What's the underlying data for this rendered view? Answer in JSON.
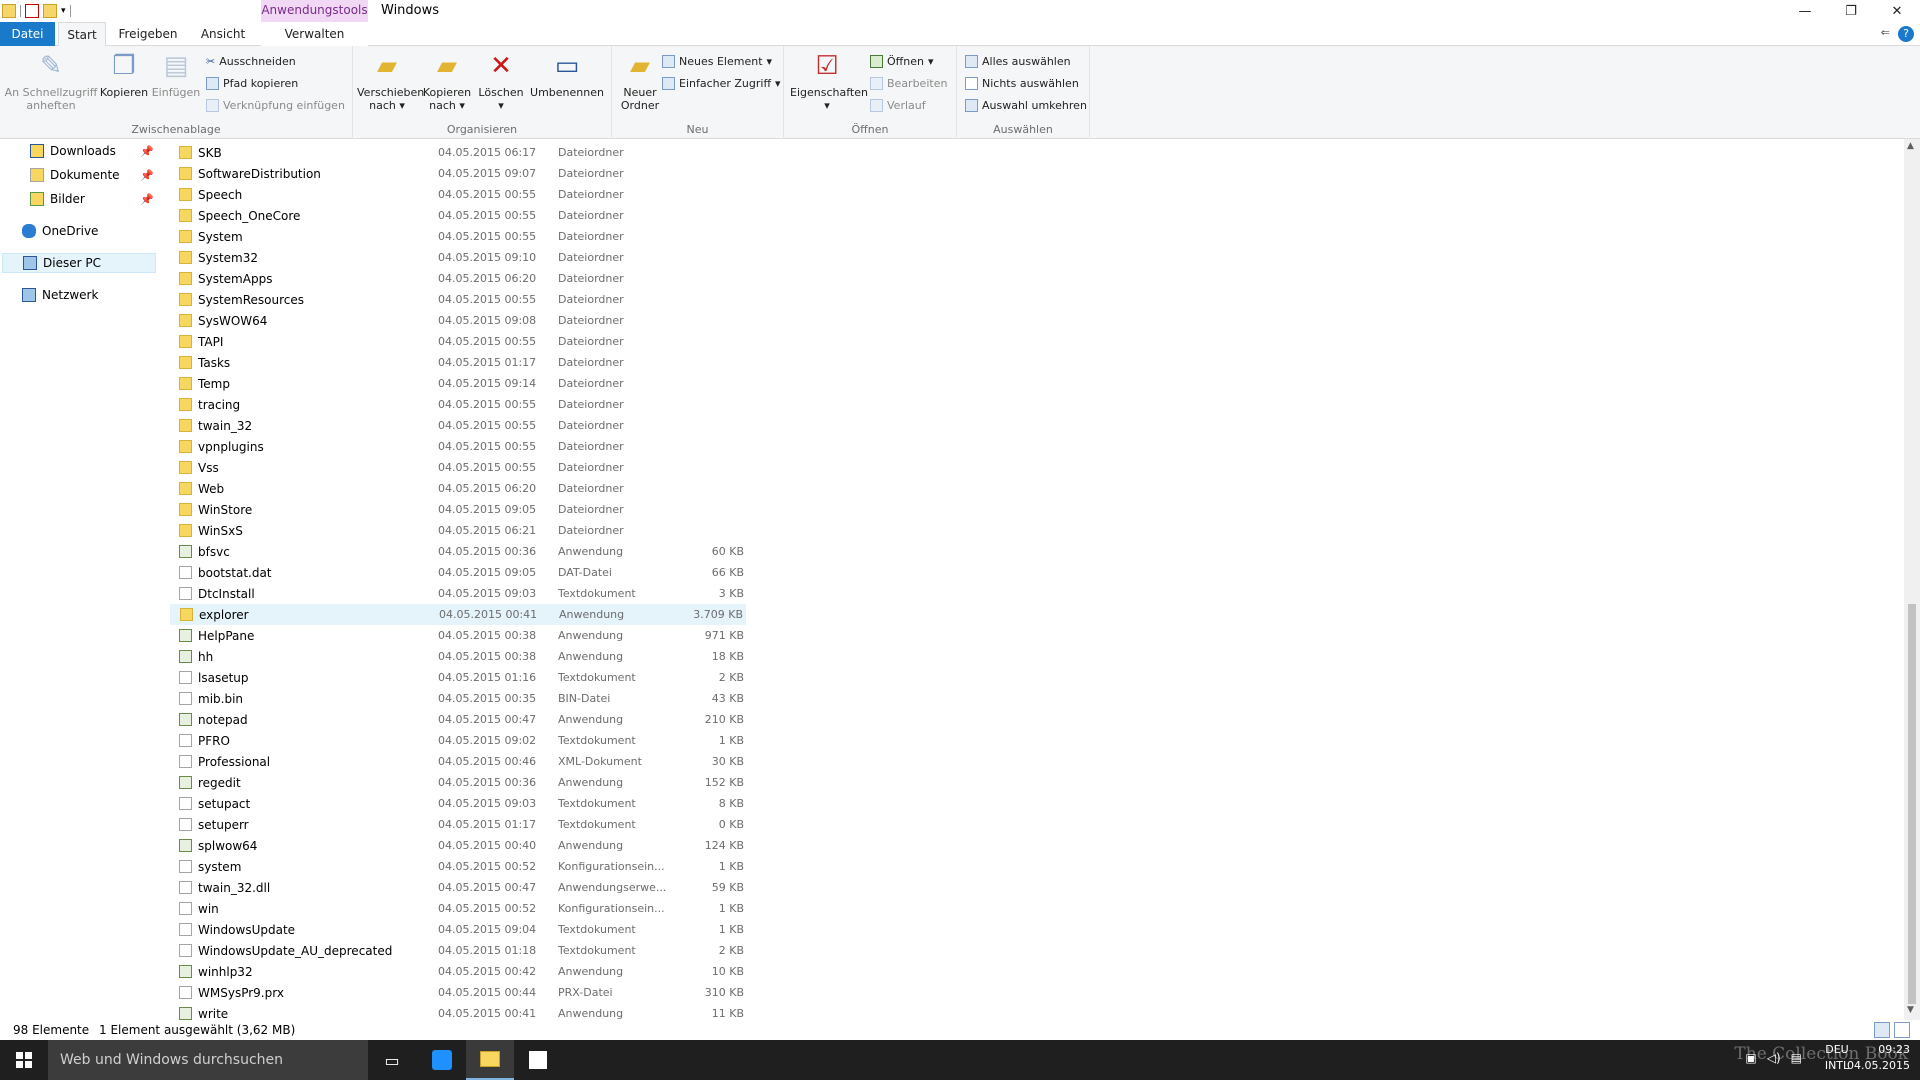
{
  "titlebar": {
    "context_header": "Anwendungstools",
    "window_title": "Windows",
    "minimize": "—",
    "maximize": "❐",
    "close": "✕"
  },
  "tabs": {
    "file": "Datei",
    "start": "Start",
    "share": "Freigeben",
    "view": "Ansicht",
    "manage": "Verwalten",
    "help": "?"
  },
  "ribbon": {
    "clipboard": {
      "label": "Zwischenablage",
      "pin": "An Schnellzugriff anheften",
      "copy": "Kopieren",
      "paste": "Einfügen",
      "cut": "Ausschneiden",
      "copy_path": "Pfad kopieren",
      "paste_shortcut": "Verknüpfung einfügen"
    },
    "organize": {
      "label": "Organisieren",
      "move_to": "Verschieben nach",
      "copy_to": "Kopieren nach",
      "delete": "Löschen",
      "rename": "Umbenennen"
    },
    "new": {
      "label": "Neu",
      "new_folder": "Neuer Ordner",
      "new_item": "Neues Element",
      "easy_access": "Einfacher Zugriff"
    },
    "open": {
      "label": "Öffnen",
      "properties": "Eigenschaften",
      "open": "Öffnen",
      "edit": "Bearbeiten",
      "history": "Verlauf"
    },
    "select": {
      "label": "Auswählen",
      "select_all": "Alles auswählen",
      "select_none": "Nichts auswählen",
      "invert": "Auswahl umkehren"
    }
  },
  "sidebar": {
    "items": [
      {
        "label": "Downloads"
      },
      {
        "label": "Dokumente"
      },
      {
        "label": "Bilder"
      },
      {
        "label": "OneDrive"
      },
      {
        "label": "Dieser PC"
      },
      {
        "label": "Netzwerk"
      }
    ]
  },
  "files": [
    {
      "name": "SKB",
      "date": "04.05.2015 06:17",
      "type": "Dateiordner",
      "size": "",
      "kind": "folder"
    },
    {
      "name": "SoftwareDistribution",
      "date": "04.05.2015 09:07",
      "type": "Dateiordner",
      "size": "",
      "kind": "folder"
    },
    {
      "name": "Speech",
      "date": "04.05.2015 00:55",
      "type": "Dateiordner",
      "size": "",
      "kind": "folder"
    },
    {
      "name": "Speech_OneCore",
      "date": "04.05.2015 00:55",
      "type": "Dateiordner",
      "size": "",
      "kind": "folder"
    },
    {
      "name": "System",
      "date": "04.05.2015 00:55",
      "type": "Dateiordner",
      "size": "",
      "kind": "folder"
    },
    {
      "name": "System32",
      "date": "04.05.2015 09:10",
      "type": "Dateiordner",
      "size": "",
      "kind": "folder"
    },
    {
      "name": "SystemApps",
      "date": "04.05.2015 06:20",
      "type": "Dateiordner",
      "size": "",
      "kind": "folder"
    },
    {
      "name": "SystemResources",
      "date": "04.05.2015 00:55",
      "type": "Dateiordner",
      "size": "",
      "kind": "folder"
    },
    {
      "name": "SysWOW64",
      "date": "04.05.2015 09:08",
      "type": "Dateiordner",
      "size": "",
      "kind": "folder"
    },
    {
      "name": "TAPI",
      "date": "04.05.2015 00:55",
      "type": "Dateiordner",
      "size": "",
      "kind": "folder"
    },
    {
      "name": "Tasks",
      "date": "04.05.2015 01:17",
      "type": "Dateiordner",
      "size": "",
      "kind": "folder"
    },
    {
      "name": "Temp",
      "date": "04.05.2015 09:14",
      "type": "Dateiordner",
      "size": "",
      "kind": "folder"
    },
    {
      "name": "tracing",
      "date": "04.05.2015 00:55",
      "type": "Dateiordner",
      "size": "",
      "kind": "folder"
    },
    {
      "name": "twain_32",
      "date": "04.05.2015 00:55",
      "type": "Dateiordner",
      "size": "",
      "kind": "folder"
    },
    {
      "name": "vpnplugins",
      "date": "04.05.2015 00:55",
      "type": "Dateiordner",
      "size": "",
      "kind": "folder"
    },
    {
      "name": "Vss",
      "date": "04.05.2015 00:55",
      "type": "Dateiordner",
      "size": "",
      "kind": "folder"
    },
    {
      "name": "Web",
      "date": "04.05.2015 06:20",
      "type": "Dateiordner",
      "size": "",
      "kind": "folder"
    },
    {
      "name": "WinStore",
      "date": "04.05.2015 09:05",
      "type": "Dateiordner",
      "size": "",
      "kind": "folder"
    },
    {
      "name": "WinSxS",
      "date": "04.05.2015 06:21",
      "type": "Dateiordner",
      "size": "",
      "kind": "folder"
    },
    {
      "name": "bfsvc",
      "date": "04.05.2015 00:36",
      "type": "Anwendung",
      "size": "60 KB",
      "kind": "app"
    },
    {
      "name": "bootstat.dat",
      "date": "04.05.2015 09:05",
      "type": "DAT-Datei",
      "size": "66 KB",
      "kind": "file"
    },
    {
      "name": "DtcInstall",
      "date": "04.05.2015 09:03",
      "type": "Textdokument",
      "size": "3 KB",
      "kind": "file"
    },
    {
      "name": "explorer",
      "date": "04.05.2015 00:41",
      "type": "Anwendung",
      "size": "3.709 KB",
      "kind": "folder"
    },
    {
      "name": "HelpPane",
      "date": "04.05.2015 00:38",
      "type": "Anwendung",
      "size": "971 KB",
      "kind": "app"
    },
    {
      "name": "hh",
      "date": "04.05.2015 00:38",
      "type": "Anwendung",
      "size": "18 KB",
      "kind": "app"
    },
    {
      "name": "lsasetup",
      "date": "04.05.2015 01:16",
      "type": "Textdokument",
      "size": "2 KB",
      "kind": "file"
    },
    {
      "name": "mib.bin",
      "date": "04.05.2015 00:35",
      "type": "BIN-Datei",
      "size": "43 KB",
      "kind": "file"
    },
    {
      "name": "notepad",
      "date": "04.05.2015 00:47",
      "type": "Anwendung",
      "size": "210 KB",
      "kind": "app"
    },
    {
      "name": "PFRO",
      "date": "04.05.2015 09:02",
      "type": "Textdokument",
      "size": "1 KB",
      "kind": "file"
    },
    {
      "name": "Professional",
      "date": "04.05.2015 00:46",
      "type": "XML-Dokument",
      "size": "30 KB",
      "kind": "file"
    },
    {
      "name": "regedit",
      "date": "04.05.2015 00:36",
      "type": "Anwendung",
      "size": "152 KB",
      "kind": "app"
    },
    {
      "name": "setupact",
      "date": "04.05.2015 09:03",
      "type": "Textdokument",
      "size": "8 KB",
      "kind": "file"
    },
    {
      "name": "setuperr",
      "date": "04.05.2015 01:17",
      "type": "Textdokument",
      "size": "0 KB",
      "kind": "file"
    },
    {
      "name": "splwow64",
      "date": "04.05.2015 00:40",
      "type": "Anwendung",
      "size": "124 KB",
      "kind": "app"
    },
    {
      "name": "system",
      "date": "04.05.2015 00:52",
      "type": "Konfigurationsein...",
      "size": "1 KB",
      "kind": "file"
    },
    {
      "name": "twain_32.dll",
      "date": "04.05.2015 00:47",
      "type": "Anwendungserwe...",
      "size": "59 KB",
      "kind": "file"
    },
    {
      "name": "win",
      "date": "04.05.2015 00:52",
      "type": "Konfigurationsein...",
      "size": "1 KB",
      "kind": "file"
    },
    {
      "name": "WindowsUpdate",
      "date": "04.05.2015 09:04",
      "type": "Textdokument",
      "size": "1 KB",
      "kind": "file"
    },
    {
      "name": "WindowsUpdate_AU_deprecated",
      "date": "04.05.2015 01:18",
      "type": "Textdokument",
      "size": "2 KB",
      "kind": "file"
    },
    {
      "name": "winhlp32",
      "date": "04.05.2015 00:42",
      "type": "Anwendung",
      "size": "10 KB",
      "kind": "app"
    },
    {
      "name": "WMSysPr9.prx",
      "date": "04.05.2015 00:44",
      "type": "PRX-Datei",
      "size": "310 KB",
      "kind": "file"
    },
    {
      "name": "write",
      "date": "04.05.2015 00:41",
      "type": "Anwendung",
      "size": "11 KB",
      "kind": "app"
    }
  ],
  "selected_file": "explorer",
  "status": {
    "count": "98 Elemente",
    "selection": "1 Element ausgewählt (3,62 MB)"
  },
  "taskbar": {
    "search_placeholder": "Web und Windows durchsuchen",
    "lang_top": "DEU",
    "lang_bottom": "INTL",
    "time": "09:23",
    "date": "04.05.2015",
    "watermark": "The Collection Book"
  }
}
